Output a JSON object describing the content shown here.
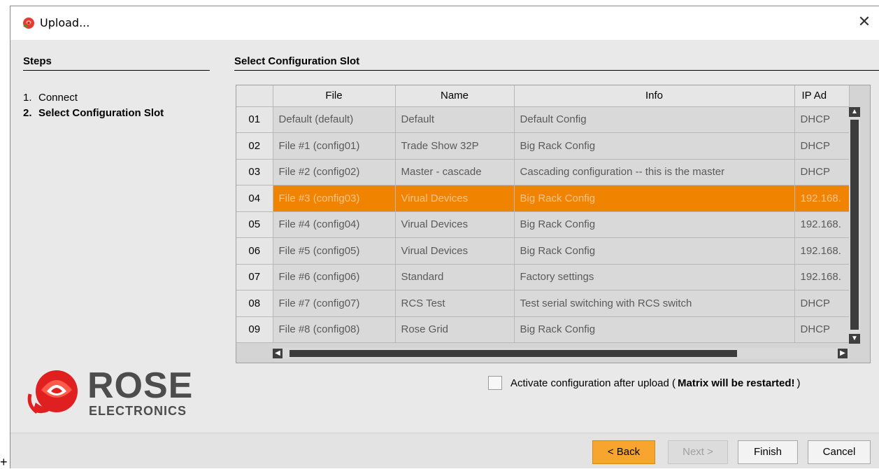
{
  "window": {
    "title": "Upload...",
    "close_glyph": "✕"
  },
  "steps": {
    "heading": "Steps",
    "items": [
      {
        "num": "1.",
        "label": "Connect"
      },
      {
        "num": "2.",
        "label": "Select Configuration Slot"
      }
    ]
  },
  "logo": {
    "line1": "ROSE",
    "line2": "ELECTRONICS",
    "color": "#e02020"
  },
  "section": {
    "title": "Select Configuration Slot"
  },
  "table": {
    "columns": [
      "",
      "File",
      "Name",
      "Info",
      "IP Ad"
    ],
    "rows": [
      {
        "num": "01",
        "file": "Default (default)",
        "name": "Default",
        "info": "Default Config",
        "ip": "DHCP"
      },
      {
        "num": "02",
        "file": "File #1 (config01)",
        "name": "Trade Show 32P",
        "info": "Big Rack Config",
        "ip": "DHCP"
      },
      {
        "num": "03",
        "file": "File #2 (config02)",
        "name": "Master - cascade",
        "info": "Cascading configuration -- this is the master",
        "ip": "DHCP"
      },
      {
        "num": "04",
        "file": "File #3 (config03)",
        "name": "Virual Devices",
        "info": "Big Rack Config",
        "ip": "192.168."
      },
      {
        "num": "05",
        "file": "File #4 (config04)",
        "name": "Virual Devices",
        "info": "Big Rack Config",
        "ip": "192.168."
      },
      {
        "num": "06",
        "file": "File #5 (config05)",
        "name": "Virual Devices",
        "info": "Big Rack Config",
        "ip": "192.168."
      },
      {
        "num": "07",
        "file": "File #6 (config06)",
        "name": "Standard",
        "info": "Factory settings",
        "ip": "192.168."
      },
      {
        "num": "08",
        "file": "File #7 (config07)",
        "name": "RCS Test",
        "info": "Test serial switching with RCS switch",
        "ip": "DHCP"
      },
      {
        "num": "09",
        "file": "File #8 (config08)",
        "name": "Rose Grid",
        "info": "Big Rack Config",
        "ip": "DHCP"
      }
    ],
    "selected_row": "04",
    "selection_color": "#f08300"
  },
  "activate": {
    "text_prefix": "Activate configuration after upload (",
    "text_bold": "Matrix will be restarted!",
    "text_suffix": ")",
    "checked": false
  },
  "buttons": {
    "back": "< Back",
    "next": "Next >",
    "finish": "Finish",
    "cancel": "Cancel"
  },
  "corner_glyph": "+"
}
